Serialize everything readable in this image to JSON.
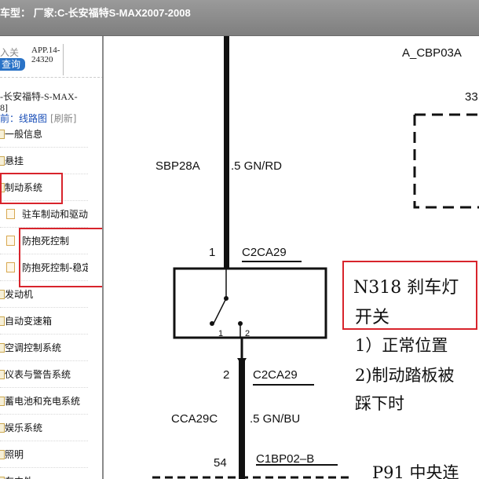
{
  "window": {
    "title": "车型：  厂家:C-长安福特S-MAX2007-2008"
  },
  "sidebar": {
    "enter_label": "入关",
    "query_button": "查询",
    "app_code_line1": "APP.14-",
    "app_code_line2": "24320",
    "model_line1": "-长安福特-S-MAX-",
    "model_line2": "8]",
    "breadcrumb_prefix": "前：",
    "breadcrumb_current": "线路图",
    "breadcrumb_refresh": "[刷新]",
    "items": [
      {
        "label": "一般信息",
        "child": false
      },
      {
        "label": "悬挂",
        "child": false
      },
      {
        "label": "制动系统",
        "child": false
      },
      {
        "label": "驻车制动和驱动",
        "child": true
      },
      {
        "label": "防抱死控制",
        "child": true
      },
      {
        "label": "防抱死控制-稳定",
        "child": true
      },
      {
        "label": "发动机",
        "child": false
      },
      {
        "label": "自动变速箱",
        "child": false
      },
      {
        "label": "空调控制系统",
        "child": false
      },
      {
        "label": "仪表与警告系统",
        "child": false
      },
      {
        "label": "蓄电池和充电系统",
        "child": false
      },
      {
        "label": "娱乐系统",
        "child": false
      },
      {
        "label": "照明",
        "child": false
      },
      {
        "label": "车内外",
        "child": false
      }
    ]
  },
  "diagram": {
    "connector_top_right": "A_CBP03A",
    "pin_33": "33",
    "wire_top_id": "SBP28A",
    "wire_top_spec": ".5 GN/RD",
    "pin_top": "1",
    "conn_top": "C2CA29",
    "switch_pin_1": "1",
    "switch_pin_2": "2",
    "pin_bottom": "2",
    "conn_bottom": "C2CA29",
    "wire_bottom_id": "CCA29C",
    "wire_bottom_spec": ".5 GN/BU",
    "pin_54": "54",
    "conn_c1bp": "C1BP02–B",
    "note_line1": "N318  刹车灯",
    "note_line2": "开关",
    "note_line3": "1）正常位置",
    "note_line4": "2)制动踏板被",
    "note_line5": "踩下时",
    "note_bottom": "P91  中央连"
  }
}
